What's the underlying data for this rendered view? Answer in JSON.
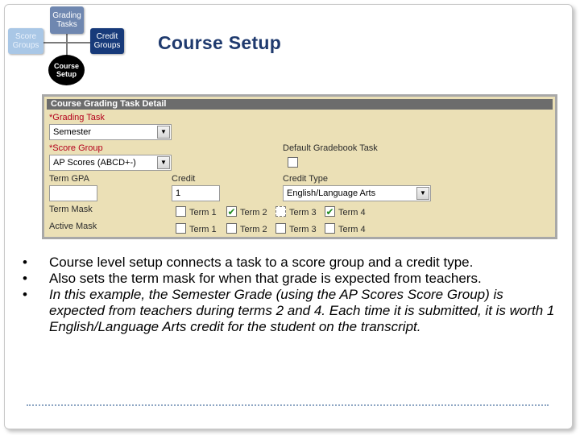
{
  "diagram": {
    "grading_tasks": "Grading Tasks",
    "score_groups": "Score Groups",
    "credit_groups": "Credit Groups",
    "course_setup": "Course Setup"
  },
  "slide": {
    "title": "Course Setup"
  },
  "panel": {
    "header": "Course Grading Task Detail",
    "grading_task_label": "*Grading Task",
    "grading_task_value": "Semester",
    "score_group_label": "*Score Group",
    "score_group_value": "AP Scores (ABCD+-)",
    "default_gradebook_label": "Default Gradebook Task",
    "term_gpa_label": "Term GPA",
    "term_gpa_value": "",
    "credit_label": "Credit",
    "credit_value": "1",
    "credit_type_label": "Credit Type",
    "credit_type_value": "English/Language Arts",
    "term_mask_label": "Term Mask",
    "active_mask_label": "Active Mask",
    "terms": [
      "Term 1",
      "Term 2",
      "Term 3",
      "Term 4"
    ],
    "term_mask_checked": [
      false,
      true,
      false,
      true
    ],
    "active_mask_checked": [
      false,
      false,
      false,
      false
    ]
  },
  "bullets": [
    {
      "text": "Course level setup connects a task to a score group and a credit type.",
      "italic": false
    },
    {
      "text": "Also sets the term mask for when that grade is expected from teachers.",
      "italic": false
    },
    {
      "text": "In this example, the Semester Grade (using the AP Scores Score Group) is expected from teachers during terms 2 and 4.  Each time it is submitted, it is worth 1 English/Language Arts credit for the student on the transcript.",
      "italic": true
    }
  ],
  "bullet_glyph": "•",
  "colors": {
    "title": "#1f3a6e",
    "panel_bg": "#ebe0b6",
    "panel_header": "#6c6c6c",
    "required_label": "#b4001c",
    "check": "#1e8a1e"
  },
  "icons": {
    "select_arrow": "chevron-down-icon",
    "check": "checkmark-icon"
  }
}
